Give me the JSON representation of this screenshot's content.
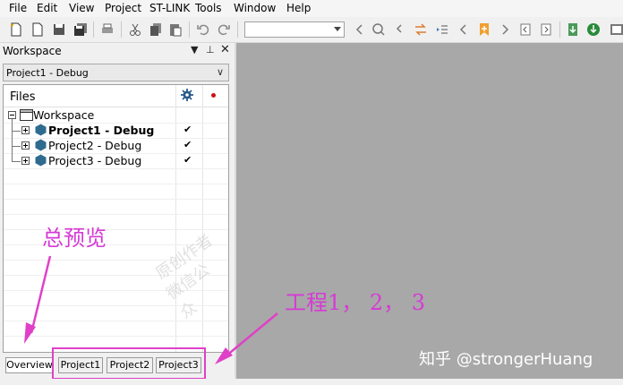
{
  "menu": [
    "File",
    "Edit",
    "View",
    "Project",
    "ST-LINK",
    "Tools",
    "Window",
    "Help"
  ],
  "toolbar": {
    "icons": [
      "new-file-icon",
      "open-icon",
      "save-icon",
      "save-all-icon",
      "print-icon",
      "cut-icon",
      "copy-icon",
      "paste-icon",
      "undo-icon",
      "redo-icon",
      "find-combo",
      "back-icon",
      "find-icon",
      "replace-icon",
      "goto-icon",
      "prev-icon",
      "bookmark-icon",
      "next-icon",
      "toggle-icon",
      "next-bookmark-icon",
      "download-icon",
      "download-debug-icon"
    ]
  },
  "workspace": {
    "title": "Workspace",
    "config_selected": "Project1 - Debug",
    "files_header": "Files",
    "root": "Workspace",
    "projects": [
      {
        "name": "Project1 - Debug",
        "bold": true,
        "checked": "✔"
      },
      {
        "name": "Project2 - Debug",
        "bold": false,
        "checked": "✔"
      },
      {
        "name": "Project3 - Debug",
        "bold": false,
        "checked": "✔"
      }
    ],
    "tabs": [
      "Overview",
      "Project1",
      "Project2",
      "Project3"
    ]
  },
  "annotations": {
    "overview_label": "总预览",
    "projects_label": "工程1， 2， 3",
    "color": "#d63ad6"
  },
  "watermark": {
    "text": "知乎 @strongerHuang"
  },
  "faint_watermark": [
    "原创作者",
    "微信公众"
  ]
}
